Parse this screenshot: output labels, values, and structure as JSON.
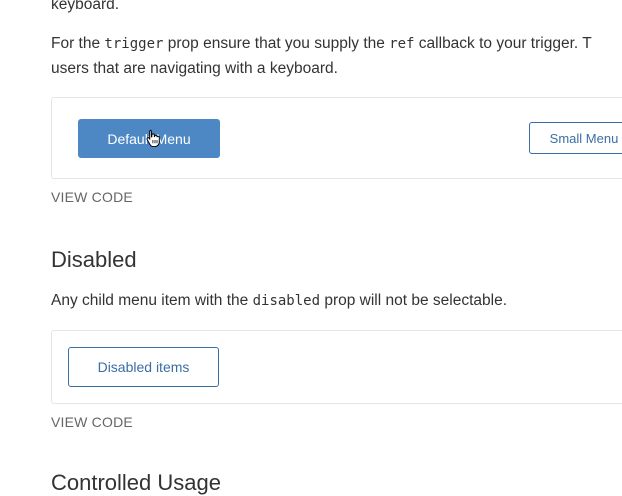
{
  "intro": {
    "line0": "keyboard.",
    "line1": {
      "a": "For the ",
      "code1": "trigger",
      "b": " prop ensure that you supply the ",
      "code2": "ref",
      "c": " callback to your trigger. T"
    },
    "line2": "users that are navigating with a keyboard."
  },
  "example1": {
    "default_menu_label": "Default Menu",
    "small_menu_label": "Small Menu",
    "view_code": "VIEW CODE"
  },
  "disabled_section": {
    "title": "Disabled",
    "desc_a": "Any child menu item with the ",
    "desc_code": "disabled",
    "desc_b": " prop will not be selectable.",
    "button_label": "Disabled items",
    "view_code": "VIEW CODE"
  },
  "controlled_section": {
    "title": "Controlled Usage"
  },
  "colors": {
    "primary": "#4d88c4",
    "outline": "#3a6ea5",
    "text": "#333333",
    "muted": "#666666"
  }
}
